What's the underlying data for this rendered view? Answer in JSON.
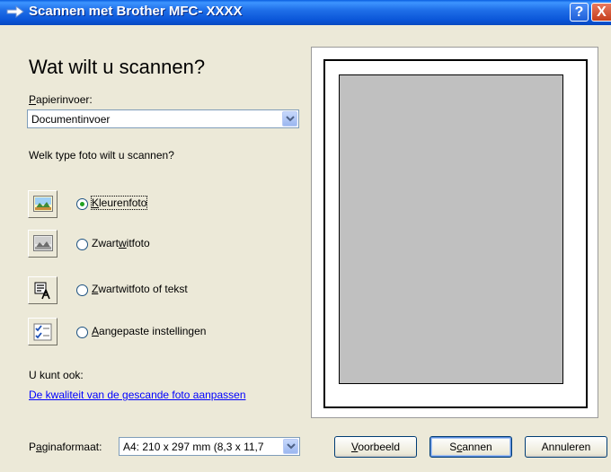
{
  "window": {
    "title": "Scannen met Brother MFC- XXXX",
    "help_button": "?",
    "close_button": "X"
  },
  "main": {
    "heading": "Wat wilt u scannen?",
    "paper_source": {
      "label_accel": "P",
      "label_rest": "apierinvoer:",
      "value": "Documentinvoer"
    },
    "photo_type_question": "Welk type foto wilt u scannen?",
    "options": [
      {
        "label_pre": "",
        "label_accel": "K",
        "label_post": "leurenfoto",
        "selected": true,
        "icon": "color-photo-icon"
      },
      {
        "label_pre": "Zwart",
        "label_accel": "w",
        "label_post": "itfoto",
        "selected": false,
        "icon": "grayscale-photo-icon"
      },
      {
        "label_pre": "",
        "label_accel": "Z",
        "label_post": "wartwitfoto of tekst",
        "selected": false,
        "icon": "text-document-icon"
      },
      {
        "label_pre": "",
        "label_accel": "A",
        "label_post": "angepaste instellingen",
        "selected": false,
        "icon": "custom-settings-icon"
      }
    ],
    "also_label": "U kunt ook:",
    "quality_link": "De kwaliteit van de gescande foto aanpassen"
  },
  "footer": {
    "page_size": {
      "label_pre": "P",
      "label_accel": "a",
      "label_post": "ginaformaat:",
      "value": "A4: 210 x 297 mm (8,3 x 11,7"
    },
    "buttons": {
      "preview": {
        "accel": "V",
        "rest": "oorbeeld"
      },
      "scan": {
        "pre": "S",
        "accel": "c",
        "rest": "annen"
      },
      "cancel": "Annuleren"
    }
  },
  "colors": {
    "titlebar": "#0a55d8",
    "dialog_bg": "#ece9d8",
    "link": "#0000ff",
    "preview_page": "#c0c0c0"
  }
}
